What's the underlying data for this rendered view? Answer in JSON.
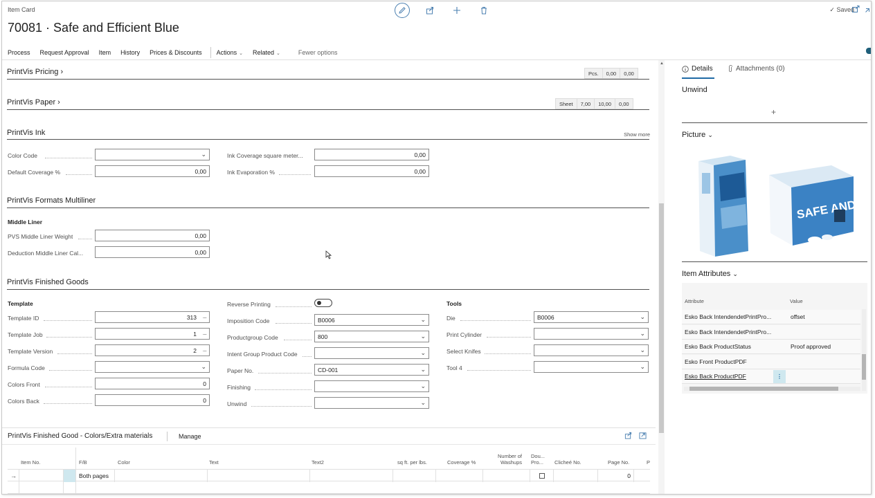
{
  "header": {
    "page_type": "Item Card",
    "title": "70081 · Safe and Efficient Blue",
    "saved": "Saved"
  },
  "menu": {
    "items": [
      "Process",
      "Request Approval",
      "Item",
      "History",
      "Prices & Discounts"
    ],
    "actions": "Actions",
    "related": "Related",
    "fewer": "Fewer options"
  },
  "pricing": {
    "title": "PrintVis Pricing",
    "cues": [
      "Pcs.",
      "0,00",
      "0,00"
    ]
  },
  "paper": {
    "title": "PrintVis Paper",
    "cues": [
      "Sheet",
      "7,00",
      "10,00",
      "0,00"
    ]
  },
  "ink": {
    "title": "PrintVis Ink",
    "show_more": "Show more",
    "color_code_label": "Color Code",
    "color_code": "",
    "default_coverage_label": "Default Coverage %",
    "default_coverage": "0,00",
    "ink_coverage_label": "Ink Coverage square meter...",
    "ink_coverage": "0,00",
    "ink_evaporation_label": "Ink Evaporation %",
    "ink_evaporation": "0,00"
  },
  "formats": {
    "title": "PrintVis Formats Multiliner",
    "group": "Middle Liner",
    "pvs_label": "PVS Middle Liner Weight",
    "pvs": "0,00",
    "deduction_label": "Deduction Middle Liner Cal...",
    "deduction": "0,00"
  },
  "finished": {
    "title": "PrintVis Finished Goods",
    "template_group": "Template",
    "template_id_label": "Template ID",
    "template_id": "313",
    "template_job_label": "Template Job",
    "template_job": "1",
    "template_version_label": "Template Version",
    "template_version": "2",
    "formula_code_label": "Formula Code",
    "formula_code": "",
    "colors_front_label": "Colors Front",
    "colors_front": "0",
    "colors_back_label": "Colors Back",
    "colors_back": "0",
    "reverse_printing_label": "Reverse Printing",
    "imposition_code_label": "Imposition Code",
    "imposition_code": "B0006",
    "productgroup_code_label": "Productgroup Code",
    "productgroup_code": "800",
    "intent_group_label": "Intent Group Product Code",
    "intent_group": "",
    "paper_no_label": "Paper No.",
    "paper_no": "CD-001",
    "finishing_label": "Finishing",
    "finishing": "",
    "unwind_label": "Unwind",
    "unwind": "",
    "tools_group": "Tools",
    "die_label": "Die",
    "die": "B0006",
    "print_cylinder_label": "Print Cylinder",
    "print_cylinder": "",
    "select_knifes_label": "Select Knifes",
    "select_knifes": "",
    "tool4_label": "Tool 4",
    "tool4": ""
  },
  "colors_part": {
    "title": "PrintVis Finished Good - Colors/Extra materials",
    "manage": "Manage",
    "columns": {
      "item_no": "Item No.",
      "fb": "F/B",
      "color": "Color",
      "text": "Text",
      "text2": "Text2",
      "sqft": "sq ft. per lbs.",
      "coverage": "Coverage %",
      "washups1": "Number of",
      "washups2": "Washups",
      "dou1": "Dou...",
      "dou2": "Pro...",
      "cliche": "Clicheé No.",
      "page_no": "Page No.",
      "p": "P"
    },
    "row": {
      "arrow": "→",
      "fb": "Both pages",
      "page_no": "0"
    }
  },
  "factbox": {
    "tabs": [
      "Details",
      "Attachments (0)"
    ],
    "unwind_title": "Unwind",
    "picture_title": "Picture",
    "picture_brand": "SAFE AND EFFICIENT",
    "attributes_title": "Item Attributes",
    "attr_col": "Attribute",
    "value_col": "Value",
    "rows": [
      {
        "attribute": "Esko Back IntendendetPrintPro...",
        "value": "offset"
      },
      {
        "attribute": "Esko Back IntendendetPrintPro...",
        "value": ""
      },
      {
        "attribute": "Esko Back ProductStatus",
        "value": "Proof approved"
      },
      {
        "attribute": "Esko Front ProductPDF",
        "value": ""
      },
      {
        "attribute": "Esko Back ProductPDF",
        "value": ""
      }
    ]
  },
  "colors": {
    "accent": "#1f6aa5",
    "selected_cell": "#cfe8ef"
  }
}
